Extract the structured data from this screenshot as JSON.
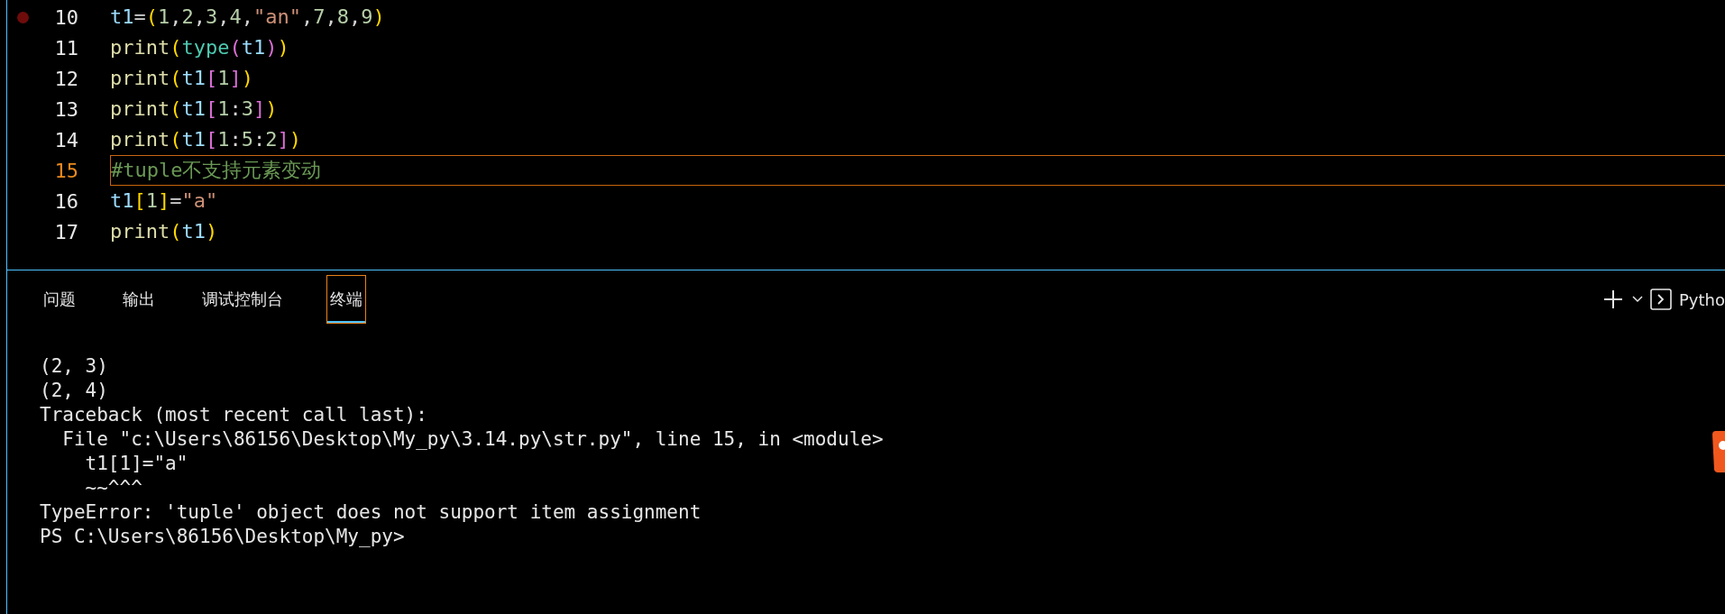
{
  "editor": {
    "lines": [
      {
        "number": "10",
        "breakpoint": true,
        "current": false,
        "tokens": [
          {
            "text": "t1",
            "kind": "var"
          },
          {
            "text": "=",
            "kind": "punct"
          },
          {
            "text": "(",
            "kind": "b1"
          },
          {
            "text": "1",
            "kind": "num"
          },
          {
            "text": ",",
            "kind": "punct"
          },
          {
            "text": "2",
            "kind": "num"
          },
          {
            "text": ",",
            "kind": "punct"
          },
          {
            "text": "3",
            "kind": "num"
          },
          {
            "text": ",",
            "kind": "punct"
          },
          {
            "text": "4",
            "kind": "num"
          },
          {
            "text": ",",
            "kind": "punct"
          },
          {
            "text": "\"an\"",
            "kind": "str"
          },
          {
            "text": ",",
            "kind": "punct"
          },
          {
            "text": "7",
            "kind": "num"
          },
          {
            "text": ",",
            "kind": "punct"
          },
          {
            "text": "8",
            "kind": "num"
          },
          {
            "text": ",",
            "kind": "punct"
          },
          {
            "text": "9",
            "kind": "num"
          },
          {
            "text": ")",
            "kind": "b1"
          }
        ]
      },
      {
        "number": "11",
        "breakpoint": false,
        "current": false,
        "tokens": [
          {
            "text": "print",
            "kind": "func"
          },
          {
            "text": "(",
            "kind": "b1"
          },
          {
            "text": "type",
            "kind": "builtin"
          },
          {
            "text": "(",
            "kind": "b2"
          },
          {
            "text": "t1",
            "kind": "var"
          },
          {
            "text": ")",
            "kind": "b2"
          },
          {
            "text": ")",
            "kind": "b1"
          }
        ]
      },
      {
        "number": "12",
        "breakpoint": false,
        "current": false,
        "tokens": [
          {
            "text": "print",
            "kind": "func"
          },
          {
            "text": "(",
            "kind": "b1"
          },
          {
            "text": "t1",
            "kind": "var"
          },
          {
            "text": "[",
            "kind": "b2"
          },
          {
            "text": "1",
            "kind": "num"
          },
          {
            "text": "]",
            "kind": "b2"
          },
          {
            "text": ")",
            "kind": "b1"
          }
        ]
      },
      {
        "number": "13",
        "breakpoint": false,
        "current": false,
        "tokens": [
          {
            "text": "print",
            "kind": "func"
          },
          {
            "text": "(",
            "kind": "b1"
          },
          {
            "text": "t1",
            "kind": "var"
          },
          {
            "text": "[",
            "kind": "b2"
          },
          {
            "text": "1",
            "kind": "num"
          },
          {
            "text": ":",
            "kind": "punct"
          },
          {
            "text": "3",
            "kind": "num"
          },
          {
            "text": "]",
            "kind": "b2"
          },
          {
            "text": ")",
            "kind": "b1"
          }
        ]
      },
      {
        "number": "14",
        "breakpoint": false,
        "current": false,
        "tokens": [
          {
            "text": "print",
            "kind": "func"
          },
          {
            "text": "(",
            "kind": "b1"
          },
          {
            "text": "t1",
            "kind": "var"
          },
          {
            "text": "[",
            "kind": "b2"
          },
          {
            "text": "1",
            "kind": "num"
          },
          {
            "text": ":",
            "kind": "punct"
          },
          {
            "text": "5",
            "kind": "num"
          },
          {
            "text": ":",
            "kind": "punct"
          },
          {
            "text": "2",
            "kind": "num"
          },
          {
            "text": "]",
            "kind": "b2"
          },
          {
            "text": ")",
            "kind": "b1"
          }
        ]
      },
      {
        "number": "15",
        "breakpoint": false,
        "current": true,
        "tokens": [
          {
            "text": "#tuple不支持元素变动",
            "kind": "comment"
          }
        ]
      },
      {
        "number": "16",
        "breakpoint": false,
        "current": false,
        "tokens": [
          {
            "text": "t1",
            "kind": "var"
          },
          {
            "text": "[",
            "kind": "b1"
          },
          {
            "text": "1",
            "kind": "num"
          },
          {
            "text": "]",
            "kind": "b1"
          },
          {
            "text": "=",
            "kind": "punct"
          },
          {
            "text": "\"a\"",
            "kind": "str"
          }
        ]
      },
      {
        "number": "17",
        "breakpoint": false,
        "current": false,
        "tokens": [
          {
            "text": "print",
            "kind": "func"
          },
          {
            "text": "(",
            "kind": "b1"
          },
          {
            "text": "t1",
            "kind": "var"
          },
          {
            "text": ")",
            "kind": "b1"
          }
        ]
      }
    ]
  },
  "panel": {
    "tabs": [
      {
        "label": "问题",
        "selected": false
      },
      {
        "label": "输出",
        "selected": false
      },
      {
        "label": "调试控制台",
        "selected": false
      },
      {
        "label": "终端",
        "selected": true
      }
    ],
    "terminal_profile": "Pytho",
    "terminal_lines": [
      "(2, 3)",
      "(2, 4)",
      "Traceback (most recent call last):",
      "  File \"c:\\Users\\86156\\Desktop\\My_py\\3.14.py\\str.py\", line 15, in <module>",
      "    t1[1]=\"a\"",
      "    ~~^^^",
      "TypeError: 'tuple' object does not support item assignment",
      "PS C:\\Users\\86156\\Desktop\\My_py>"
    ]
  }
}
